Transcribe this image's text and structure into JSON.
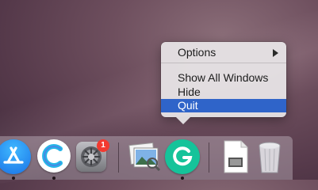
{
  "context_menu": {
    "items": [
      {
        "label": "Options",
        "has_submenu": true
      },
      {
        "label": "Show All Windows"
      },
      {
        "label": "Hide"
      },
      {
        "label": "Quit",
        "highlighted": true
      }
    ],
    "highlight_color": "#2f64c9"
  },
  "dock": {
    "apps": [
      {
        "name": "app-store-icon",
        "running": true
      },
      {
        "name": "contacts-c-icon",
        "running": true
      },
      {
        "name": "system-preferences-icon",
        "running": false,
        "badge": "1"
      },
      {
        "name": "preview-icon",
        "running": false
      },
      {
        "name": "grammarly-icon",
        "running": true
      },
      {
        "name": "document-icon",
        "running": false
      },
      {
        "name": "trash-icon",
        "running": false
      }
    ]
  }
}
